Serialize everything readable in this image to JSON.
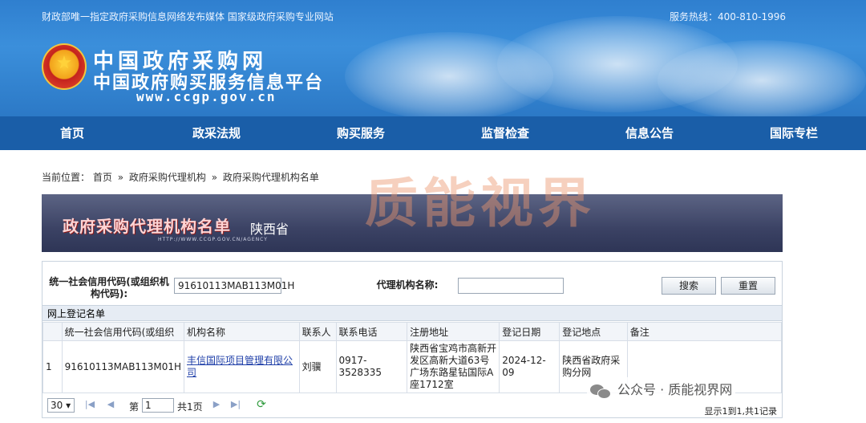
{
  "header": {
    "tagline": "财政部唯一指定政府采购信息网络发布媒体 国家级政府采购专业网站",
    "hotline": "服务热线：400-810-1996",
    "logo_title": "中国政府采购网",
    "logo_subtitle": "中国政府购买服务信息平台",
    "logo_url": "www.ccgp.gov.cn"
  },
  "nav": {
    "items": [
      "首页",
      "政采法规",
      "购买服务",
      "监督检查",
      "信息公告",
      "国际专栏"
    ]
  },
  "breadcrumb": {
    "prefix": "当前位置：",
    "items": [
      "首页",
      "政府采购代理机构",
      "政府采购代理机构名单"
    ],
    "separator": "»"
  },
  "watermark": "质能视界",
  "banner": {
    "title": "政府采购代理机构名单",
    "province": "陕西省",
    "url": "HTTP://WWW.CCGP.GOV.CN/AGENCY"
  },
  "search": {
    "credit_label": "统一社会信用代码(或组织机构代码):",
    "credit_value": "91610113MAB113M01H",
    "name_label": "代理机构名称:",
    "name_value": "",
    "search_button": "搜索",
    "reset_button": "重置"
  },
  "list": {
    "title": "网上登记名单",
    "columns": [
      "",
      "统一社会信用代码(或组织",
      "机构名称",
      "联系人",
      "联系电话",
      "注册地址",
      "登记日期",
      "登记地点",
      "备注"
    ],
    "rows": [
      {
        "index": "1",
        "code": "91610113MAB113M01H",
        "name": "丰信国际项目管理有限公司",
        "contact": "刘骥",
        "phone": "0917-3528335",
        "address": "陕西省宝鸡市高新开发区高新大道63号广场东路星钻国际A座1712室",
        "date": "2024-12-09",
        "place": "陕西省政府采购分网",
        "note": ""
      }
    ]
  },
  "pager": {
    "page_size": "30",
    "page_prefix": "第",
    "page_value": "1",
    "page_total": "共1页",
    "info": "显示1到1,共1记录"
  },
  "wechat": {
    "label": "公众号 · 质能视界网"
  },
  "colors": {
    "header_blue": "#3b8fdb",
    "nav_blue": "#1a5ea8",
    "link_blue": "#1f3fa8",
    "banner_navy": "#3b4264"
  }
}
